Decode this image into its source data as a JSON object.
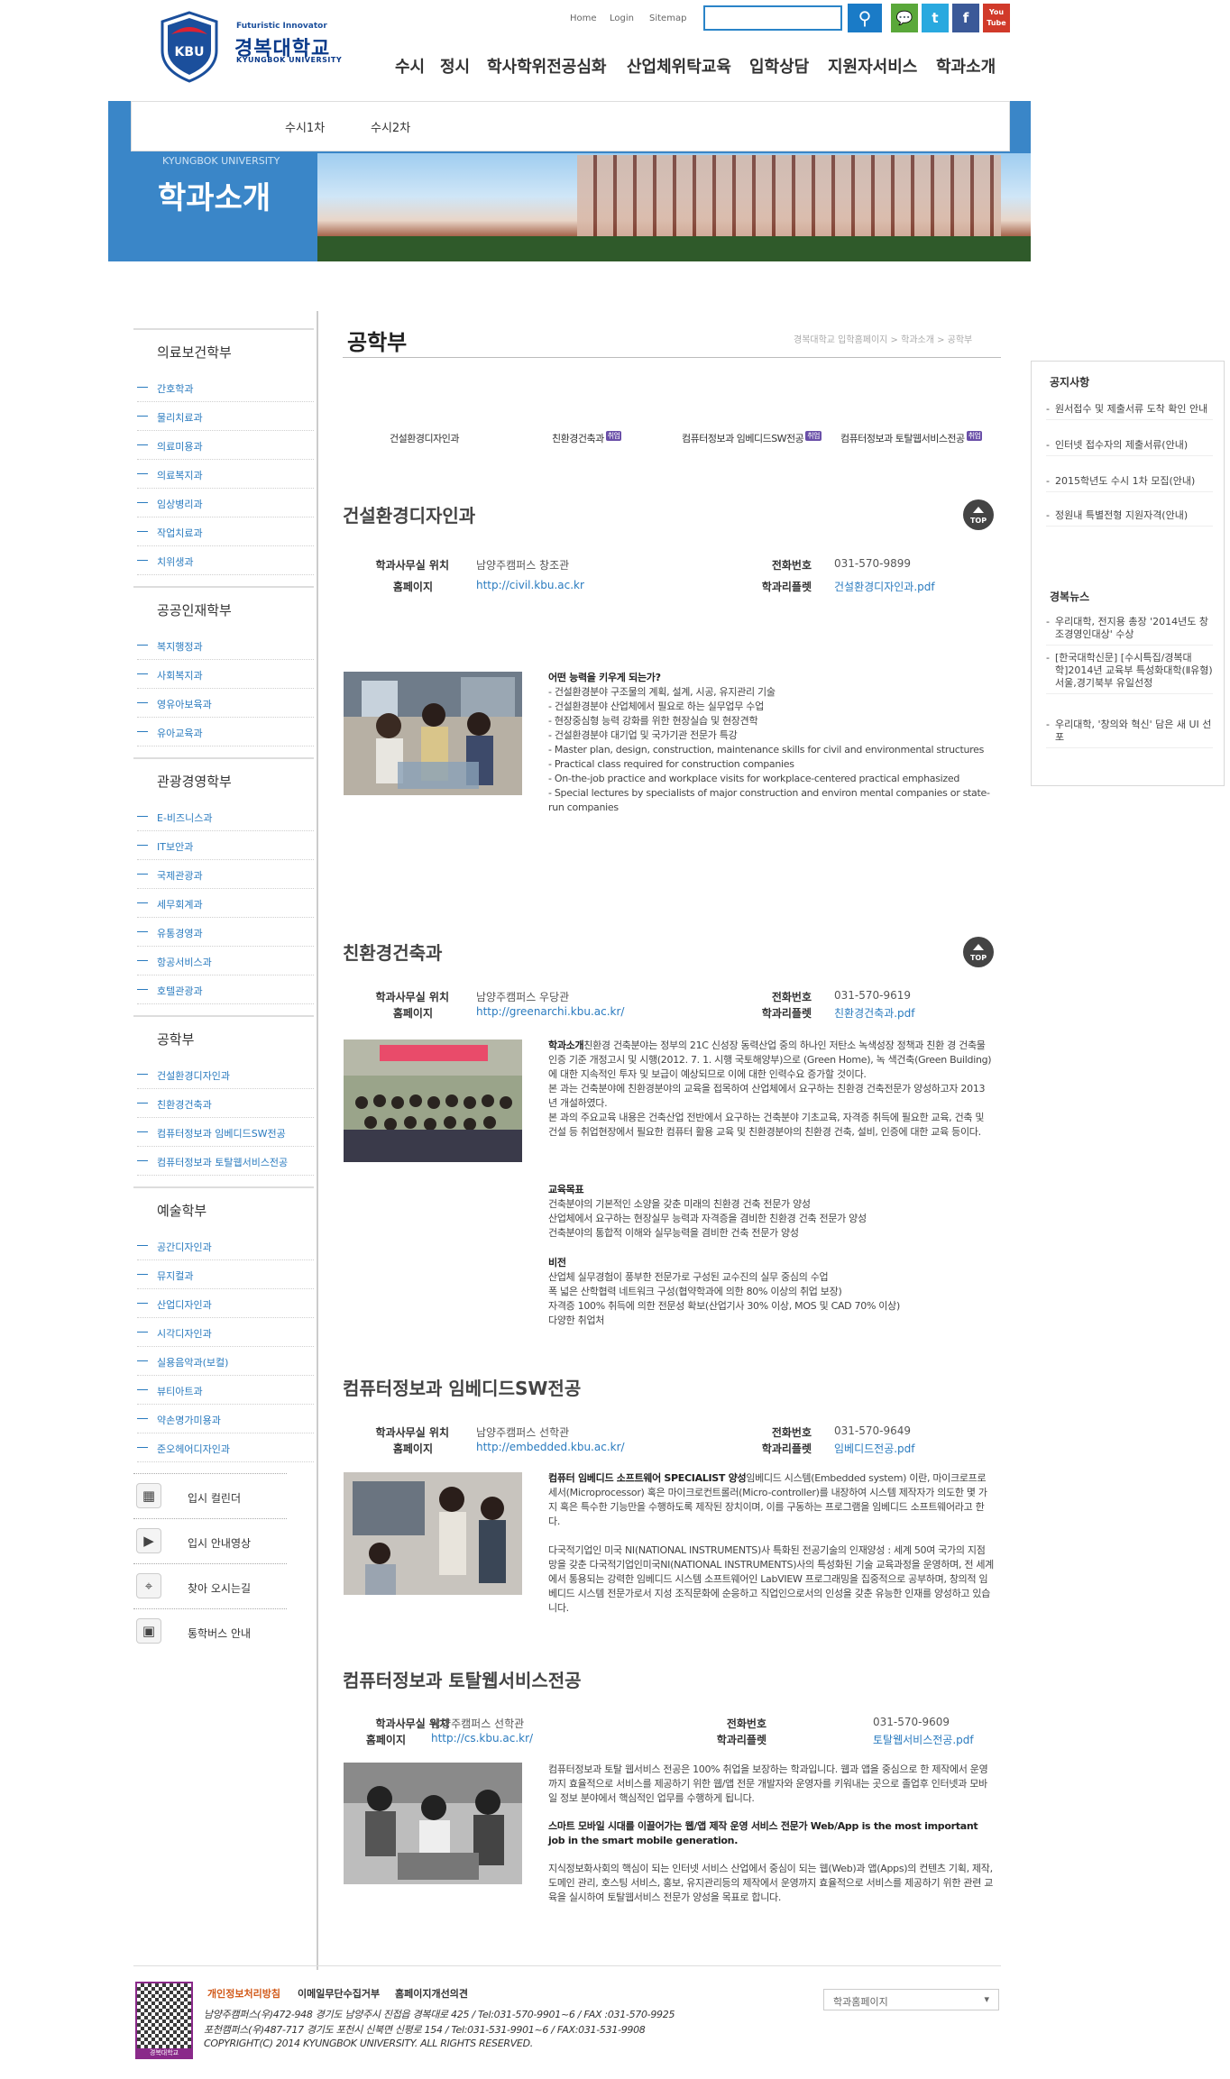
{
  "header": {
    "logo_small": "Futuristic Innovator",
    "logo_name": "경복대학교",
    "logo_en": "KYUNGBOK UNIVERSITY",
    "logo_badge": "KBU",
    "utils": [
      "Home",
      "Login",
      "Sitemap"
    ],
    "sns": [
      {
        "name": "talk",
        "label": "💬",
        "color": "#5aa83a"
      },
      {
        "name": "twitter",
        "label": "t",
        "color": "#29a9df"
      },
      {
        "name": "facebook",
        "label": "f",
        "color": "#3b5998"
      },
      {
        "name": "youtube",
        "label": "You Tube",
        "color": "#d13a2a"
      }
    ],
    "gnb": [
      "수시",
      "정시",
      "학사학위전공심화",
      "산업체위탁교육",
      "입학상담",
      "지원자서비스",
      "학과소개"
    ]
  },
  "hero": {
    "subnav": [
      "수시1차",
      "수시2차"
    ],
    "en": "KYUNGBOK UNIVERSITY",
    "title": "학과소개"
  },
  "sidebar": {
    "groups": [
      {
        "title": "의료보건학부",
        "items": [
          "간호학과",
          "물리치료과",
          "의료미용과",
          "의료복지과",
          "임상병리과",
          "작업치료과",
          "치위생과"
        ]
      },
      {
        "title": "공공인재학부",
        "items": [
          "복지행정과",
          "사회복지과",
          "영유아보육과",
          "유아교육과"
        ]
      },
      {
        "title": "관광경영학부",
        "items": [
          "E-비즈니스과",
          "IT보안과",
          "국제관광과",
          "세무회계과",
          "유통경영과",
          "항공서비스과",
          "호텔관광과"
        ]
      },
      {
        "title": "공학부",
        "items": [
          "건설환경디자인과",
          "친환경건축과",
          "컴퓨터정보과 임베디드SW전공",
          "컴퓨터정보과 토탈웹서비스전공"
        ]
      },
      {
        "title": "예술학부",
        "items": [
          "공간디자인과",
          "뮤지컬과",
          "산업디자인과",
          "시각디자인과",
          "실용음악과(보컬)",
          "뷰티아트과",
          "약손명가미용과",
          "준오헤어디자인과"
        ]
      }
    ],
    "quick": [
      {
        "icon": "calendar-icon",
        "glyph": "▦",
        "label": "입시 컬린더"
      },
      {
        "icon": "video-icon",
        "glyph": "▶",
        "label": "입시 안내영상"
      },
      {
        "icon": "map-pin-icon",
        "glyph": "⌖",
        "label": "찾아 오시는길"
      },
      {
        "icon": "bus-icon",
        "glyph": "▣",
        "label": "통학버스 안내"
      }
    ]
  },
  "main": {
    "title": "공학부",
    "breadcrumb": "경복대학교 입학홈페이지 > 학과소개 > 공학부",
    "tabs": [
      {
        "label": "건설환경디자인과",
        "badge": ""
      },
      {
        "label": "친환경건축과",
        "badge": "취업"
      },
      {
        "label": "컴퓨터정보과 임베디드SW전공",
        "badge": "취업"
      },
      {
        "label": "컴퓨터정보과 토탈웹서비스전공",
        "badge": "취업"
      }
    ],
    "labels": {
      "office": "학과사무실 위치",
      "homepage": "홈페이지",
      "phone": "전화번호",
      "leaflet": "학과리플렛",
      "top": "TOP"
    },
    "sections": [
      {
        "name": "건설환경디자인과",
        "office": "남양주캠퍼스 창조관",
        "homepage": "http://civil.kbu.ac.kr",
        "phone": "031-570-9899",
        "leaflet": "건설환경디자인과.pdf",
        "desc_title": "어떤 능력을 키우게 되는가?",
        "desc": "- 건설환경분야 구조물의 계획, 설계, 시공, 유지관리 기술\n- 건설환경분야 산업체에서 필요로 하는 실무업무 수업\n- 현장중심형 능력 강화를 위한 현장실습 및 현장견학\n- 건설환경분야 대기업 및 국가기관 전문가 특강\n- Master plan, design, construction, maintenance skills for civil and environmental structures\n- Practical class required for construction companies\n- On-the-job practice and workplace visits for workplace-centered practical emphasized\n- Special lectures by specialists of major construction and environ mental companies or state-run companies"
      },
      {
        "name": "친환경건축과",
        "office": "남양주캠퍼스 우당관",
        "homepage": "http://greenarchi.kbu.ac.kr/",
        "phone": "031-570-9619",
        "leaflet": "친환경건축과.pdf",
        "desc_title": "학과소개",
        "desc": "친환경 건축분야는 정부의 21C 신성장 동력산업 중의 하나인 저탄소 녹색성장 정책과 친환 경 건축물 인증 기준 개정고시 및 시행(2012. 7. 1. 시행 국토해양부)으로 (Green Home), 녹 색건축(Green Building)에 대한 지속적인 투자 및 보급이 예상되므로 이에 대한 인력수요 증가할 것이다.\n본 과는 건축분야에 친환경분야의 교육을 접목하여 산업체에서 요구하는 친환경 건축전문가 양성하고자 2013년 개설하였다.\n본 과의 주요교육 내용은 건축산업 전반에서 요구하는 건축분야 기초교육, 자격증 취득에 필요한 교육, 건축 및 건설 등 취업현장에서 필요한 컴퓨터 활용 교육 및 친환경분야의 친환경 건축, 설비, 인증에 대한 교육 등이다.",
        "goal_title": "교육목표",
        "goal": "건축분야의 기본적인 소양을 갖춘 미래의 친환경 건축 전문가 양성\n산업체에서 요구하는 현장실무 능력과 자격증을 겸비한 친환경 건축 전문가 양성\n건축분야의 통합적 이해와 실무능력을 겸비한 건축 전문가 양성",
        "vision_title": "비전",
        "vision": "산업체 실무경험이 풍부한 전문가로 구성된 교수진의 실무 중심의 수업\n폭 넓은 산학협력 네트워크 구성(협약학과에 의한 80% 이상의 취업 보장)\n자격증 100% 취득에 의한 전문성 확보(산업기사 30% 이상, MOS 및 CAD 70% 이상)\n다양한 취업처"
      },
      {
        "name": "컴퓨터정보과 임베디드SW전공",
        "office": "남양주캠퍼스 선학관",
        "homepage": "http://embedded.kbu.ac.kr/",
        "phone": "031-570-9649",
        "leaflet": "임베디드전공.pdf",
        "desc_title": "컴퓨터 임베디드 소프트웨어 SPECIALIST 양성",
        "desc": "임베디드 시스템(Embedded system) 이란, 마이크로프로세서(Microprocessor) 혹은 마이크로컨트롤러(Micro-controller)를 내장하여 시스템 제작자가 의도한 몇 가지 혹은 특수한 기능만을 수행하도록 제작된 장치이며, 이를 구동하는 프로그램을 임베디드 소프트웨어라고 한다.\n\n다국적기업인 미국 NI(NATIONAL INSTRUMENTS)사 특화된 전공기술의 인재양성 : 세계 50여 국가의 지점망을 갖춘 다국적기업인미국NI(NATIONAL INSTRUMENTS)사의 특성화된 기술 교육과정을 운영하며, 전 세계에서 통용되는 강력한 임베디드 시스템 소프트웨어인 LabVIEW 프로그래밍을 집중적으로 공부하며, 창의적 임베디드 시스템 전문가로서 지성 조직문화에 순응하고 직업인으로서의 인성을 갖춘 유능한 인재를 양성하고 있습니다."
      },
      {
        "name": "컴퓨터정보과 토탈웹서비스전공",
        "office": "남양주캠퍼스 선학관",
        "homepage": "http://cs.kbu.ac.kr/",
        "phone": "031-570-9609",
        "leaflet": "토탈웹서비스전공.pdf",
        "desc": "컴퓨터정보과 토탈 웹서비스 전공은 100% 취업을 보장하는 학과입니다. 웹과 앱을 중심으로 한 제작에서 운영까지 효율적으로 서비스를 제공하기 위한 웹/앱 전문 개발자와 운영자를 키워내는 곳으로 졸업후 인터넷과 모바일 정보 분야에서 핵심적인 업무를 수행하게 됩니다.",
        "bold": "스마트 모바일 시대를 이끌어가는 웹/앱 제작 운영 서비스 전문가 Web/App is the most important job in the smart mobile generation.",
        "desc2": "지식정보화사회의 핵심이 되는 인터넷 서비스 산업에서 중심이 되는 웹(Web)과 앱(Apps)의 컨텐츠 기획, 제작, 도메인 관리, 호스팅 서비스, 홍보, 유지관리등의 제작에서 운영까지 효율적으로 서비스를 제공하기 위한 관련 교육을 실시하여 토탈웹서비스 전문가 양성을 목표로 합니다."
      }
    ]
  },
  "right": {
    "notice_title": "공지사항",
    "notices": [
      "원서접수 및 제출서류 도착 확인 안내",
      "인터넷 접수자의 제출서류(안내)",
      "2015학년도 수시 1차 모집(안내)",
      "정원내 특별전형 지원자격(안내)"
    ],
    "news_title": "경복뉴스",
    "news": [
      "우리대학, 전지용 총장 '2014년도 창조경영인대상' 수상",
      "[한국대학신문] [수시특집/경복대학]2014년 교육부 특성화대학(Ⅱ유형) 서울,경기북부 유일선정",
      "우리대학, '창의와 혁신' 담은 새 UI 선포"
    ]
  },
  "footer": {
    "nav": [
      "개인정보처리방침",
      "이메일무단수집거부",
      "홈페이지개선의견"
    ],
    "addr1": "남양주캠퍼스(우)472-948 경기도 남양주시 진접읍 경복대로 425 / Tel:031-570-9901~6 / FAX :031-570-9925",
    "addr2": "포천캠퍼스(우)487-717 경기도 포천시 신북면 신평로 154 / Tel:031-531-9901~6 / FAX:031-531-9908",
    "copy": "COPYRIGHT(C) 2014 KYUNGBOK UNIVERSITY. ALL RIGHTS RESERVED.",
    "qr_label": "경복대학교",
    "select": "학과홈페이지"
  }
}
